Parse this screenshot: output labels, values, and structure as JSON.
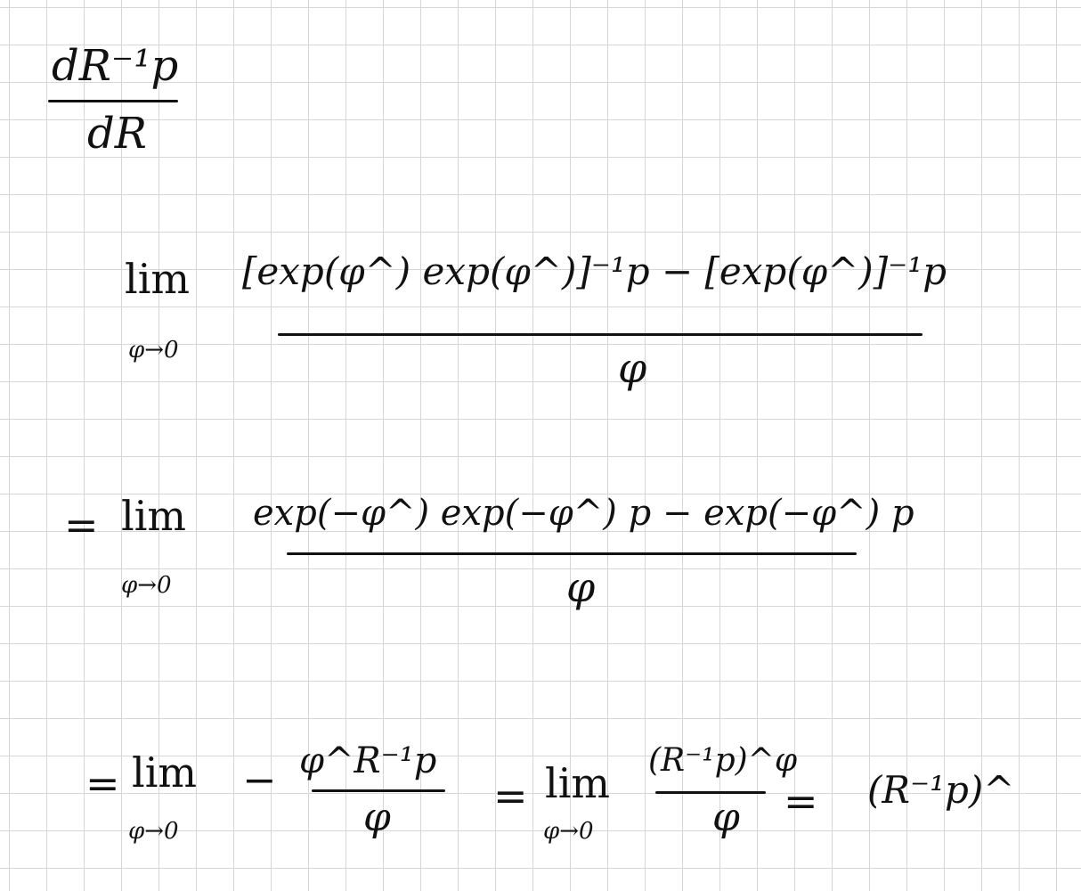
{
  "ink_color": "#111111",
  "grid_color": "#d6d6d6",
  "derivative": {
    "numerator": "dR⁻¹p",
    "denominator": "dR"
  },
  "line1": {
    "lim": "lim",
    "lim_sub": "φ→0",
    "numerator": "[exp(φ^) exp(φ^)]⁻¹p − [exp(φ^)]⁻¹p",
    "denominator": "φ"
  },
  "line2": {
    "equals": "=",
    "lim": "lim",
    "lim_sub": "φ→0",
    "numerator": "exp(−φ^) exp(−φ^) p − exp(−φ^) p",
    "denominator": "φ"
  },
  "line3": {
    "equals": "=",
    "lim": "lim",
    "lim_sub": "φ→0",
    "minus": "−",
    "numerator_a": "φ^R⁻¹p",
    "denominator_a": "φ",
    "equals2": "=",
    "lim2": "lim",
    "lim2_sub": "φ→0",
    "numerator_b": "(R⁻¹p)^φ",
    "denominator_b": "φ",
    "equals3": "=",
    "result": "(R⁻¹p)^"
  }
}
